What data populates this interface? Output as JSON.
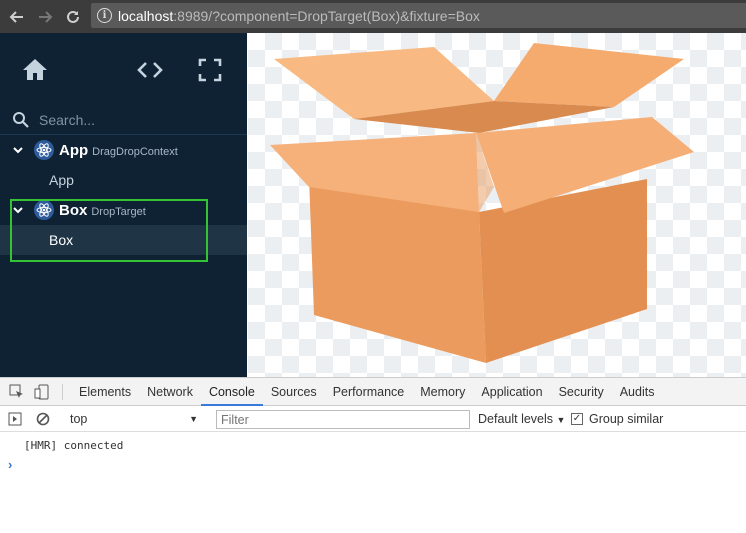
{
  "browser": {
    "url_host": "localhost",
    "url_rest": ":8989/?component=DropTarget(Box)&fixture=Box",
    "back_icon": "back-arrow-icon",
    "forward_icon": "forward-arrow-icon",
    "reload_icon": "reload-icon"
  },
  "sidebar": {
    "search_placeholder": "Search...",
    "components": [
      {
        "name": "App",
        "hoc": "DragDropContext",
        "fixture": "App"
      },
      {
        "name": "Box",
        "hoc": "DropTarget",
        "fixture": "Box"
      }
    ],
    "colors": {
      "bg": "#0f2233",
      "selected": "#1f3546",
      "highlight": "#35c235"
    }
  },
  "preview": {
    "image": "cardboard-box-illustration",
    "box_color": "#f0a46a"
  },
  "devtools": {
    "tabs": [
      "Elements",
      "Network",
      "Console",
      "Sources",
      "Performance",
      "Memory",
      "Application",
      "Security",
      "Audits"
    ],
    "active_tab": "Console",
    "context": "top",
    "filter_placeholder": "Filter",
    "levels": "Default levels",
    "group_similar": "Group similar",
    "messages": [
      "[HMR] connected"
    ]
  }
}
